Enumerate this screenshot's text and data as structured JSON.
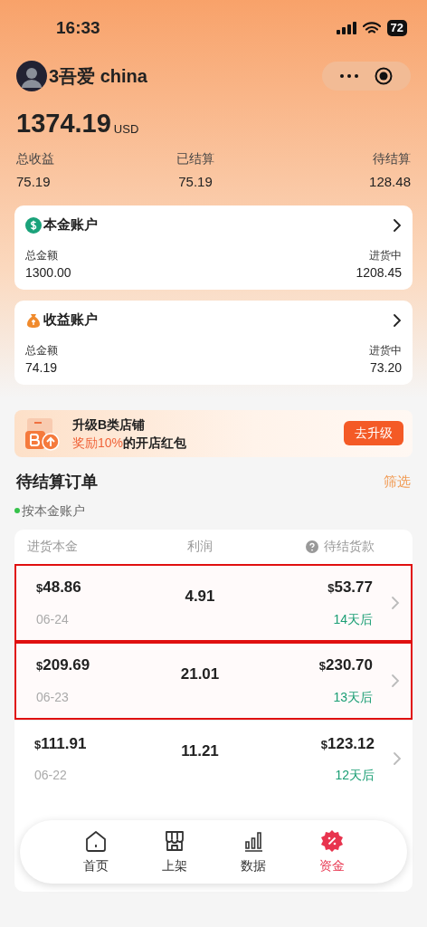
{
  "status_bar": {
    "time": "16:33",
    "battery": "72"
  },
  "profile": {
    "name": "3吾爱 china"
  },
  "balance": {
    "amount": "1374.19",
    "currency": "USD"
  },
  "stats": [
    {
      "label": "总收益",
      "value": "75.19"
    },
    {
      "label": "已结算",
      "value": "75.19"
    },
    {
      "label": "待结算",
      "value": "128.48"
    }
  ],
  "accounts": [
    {
      "kind": "principal",
      "title": "本金账户",
      "left_label": "总金额",
      "left_value": "1300.00",
      "right_label": "进货中",
      "right_value": "1208.45"
    },
    {
      "kind": "earnings",
      "title": "收益账户",
      "left_label": "总金额",
      "left_value": "74.19",
      "right_label": "进货中",
      "right_value": "73.20"
    }
  ],
  "banner": {
    "title": "升级B类店铺",
    "subtitle": "**奖励10%**的开店红包",
    "button": "去升级"
  },
  "orders": {
    "title": "待结算订单",
    "filter": "筛选",
    "account": "按本金账户",
    "columns": [
      "进货本金",
      "利润",
      "待结货款"
    ],
    "rows": [
      {
        "principal": "48.86",
        "profit": "4.91",
        "payout": "53.77",
        "date": "06-24",
        "due": "14天后",
        "highlighted": true
      },
      {
        "principal": "209.69",
        "profit": "21.01",
        "payout": "230.70",
        "date": "06-23",
        "due": "13天后",
        "highlighted": true
      },
      {
        "principal": "111.91",
        "profit": "11.21",
        "payout": "123.12",
        "date": "06-22",
        "due": "12天后",
        "highlighted": false
      }
    ],
    "currency_symbol": "$"
  },
  "tab_bar": [
    {
      "kind": "home",
      "label": "首页",
      "selected": false
    },
    {
      "kind": "shop",
      "label": "上架",
      "selected": false
    },
    {
      "kind": "data",
      "label": "数据",
      "selected": false
    },
    {
      "kind": "funds",
      "label": "资金",
      "selected": true
    }
  ]
}
